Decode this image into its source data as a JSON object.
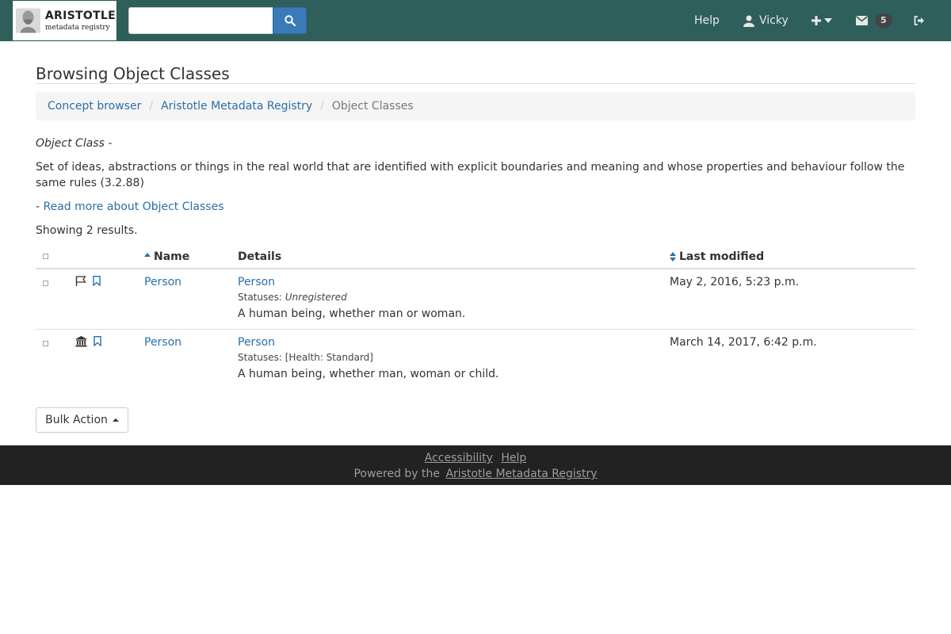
{
  "navbar": {
    "logo": {
      "title": "ARISTOTLE",
      "subtitle": "metadata registry"
    },
    "search": {
      "value": "",
      "placeholder": ""
    },
    "help_label": "Help",
    "user_label": "Vicky",
    "mail_count": "5"
  },
  "page": {
    "title": "Browsing Object Classes",
    "breadcrumb": [
      "Concept browser",
      "Aristotle Metadata Registry",
      "Object Classes"
    ],
    "type_label": "Object Class -",
    "definition": "Set of ideas, abstractions or things in the real world that are identified with explicit boundaries and meaning and whose properties and behaviour follow the same rules (3.2.88)",
    "read_more_prefix": "-",
    "read_more_label": "Read more about Object Classes",
    "results_count": "Showing 2 results."
  },
  "table": {
    "headers": {
      "name": "Name",
      "details": "Details",
      "last_modified": "Last modified"
    },
    "rows": [
      {
        "name": "Person",
        "details_title": "Person",
        "status_label": "Statuses:",
        "status_value": "Unregistered",
        "definition": "A human being, whether man or woman.",
        "last_modified": "May 2, 2016, 5:23 p.m."
      },
      {
        "name": "Person",
        "details_title": "Person",
        "status_label": "Statuses:",
        "status_value": "[Health: Standard]",
        "definition": "A human being, whether man, woman or child.",
        "last_modified": "March 14, 2017, 6:42 p.m."
      }
    ]
  },
  "bulk_action_label": "Bulk Action",
  "footer": {
    "accessibility": "Accessibility",
    "help": "Help",
    "powered_by": "Powered by the",
    "registry_link": "Aristotle Metadata Registry"
  },
  "colors": {
    "navbar": "#2f5f5a",
    "link": "#2a6fa8",
    "footer": "#222222",
    "search_button": "#3a7ab8"
  }
}
